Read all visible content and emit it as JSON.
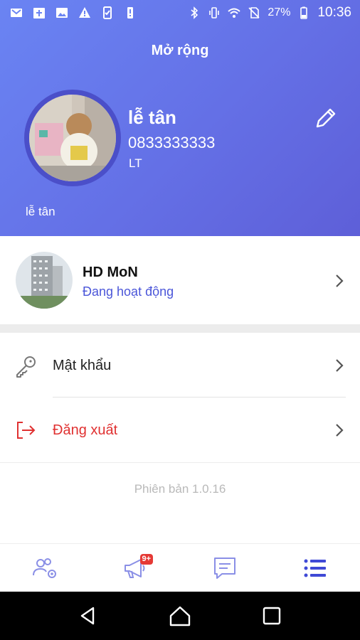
{
  "status_bar": {
    "battery": "27%",
    "time": "10:36"
  },
  "header": {
    "title": "Mở rộng"
  },
  "profile": {
    "name": "lễ tân",
    "phone": "0833333333",
    "code": "LT",
    "subtitle": "lễ tân"
  },
  "organization": {
    "name": "HD MoN",
    "status": "Đang hoạt động"
  },
  "menu": {
    "password_label": "Mật khẩu",
    "logout_label": "Đăng xuất"
  },
  "footer": {
    "version": "Phiên bản 1.0.16"
  },
  "tabs": {
    "notifications_badge": "9+"
  },
  "colors": {
    "accent": "#5e63dc",
    "tab_icon": "#8a8fe6",
    "logout_red": "#e03131",
    "link_blue": "#4b56d9"
  }
}
